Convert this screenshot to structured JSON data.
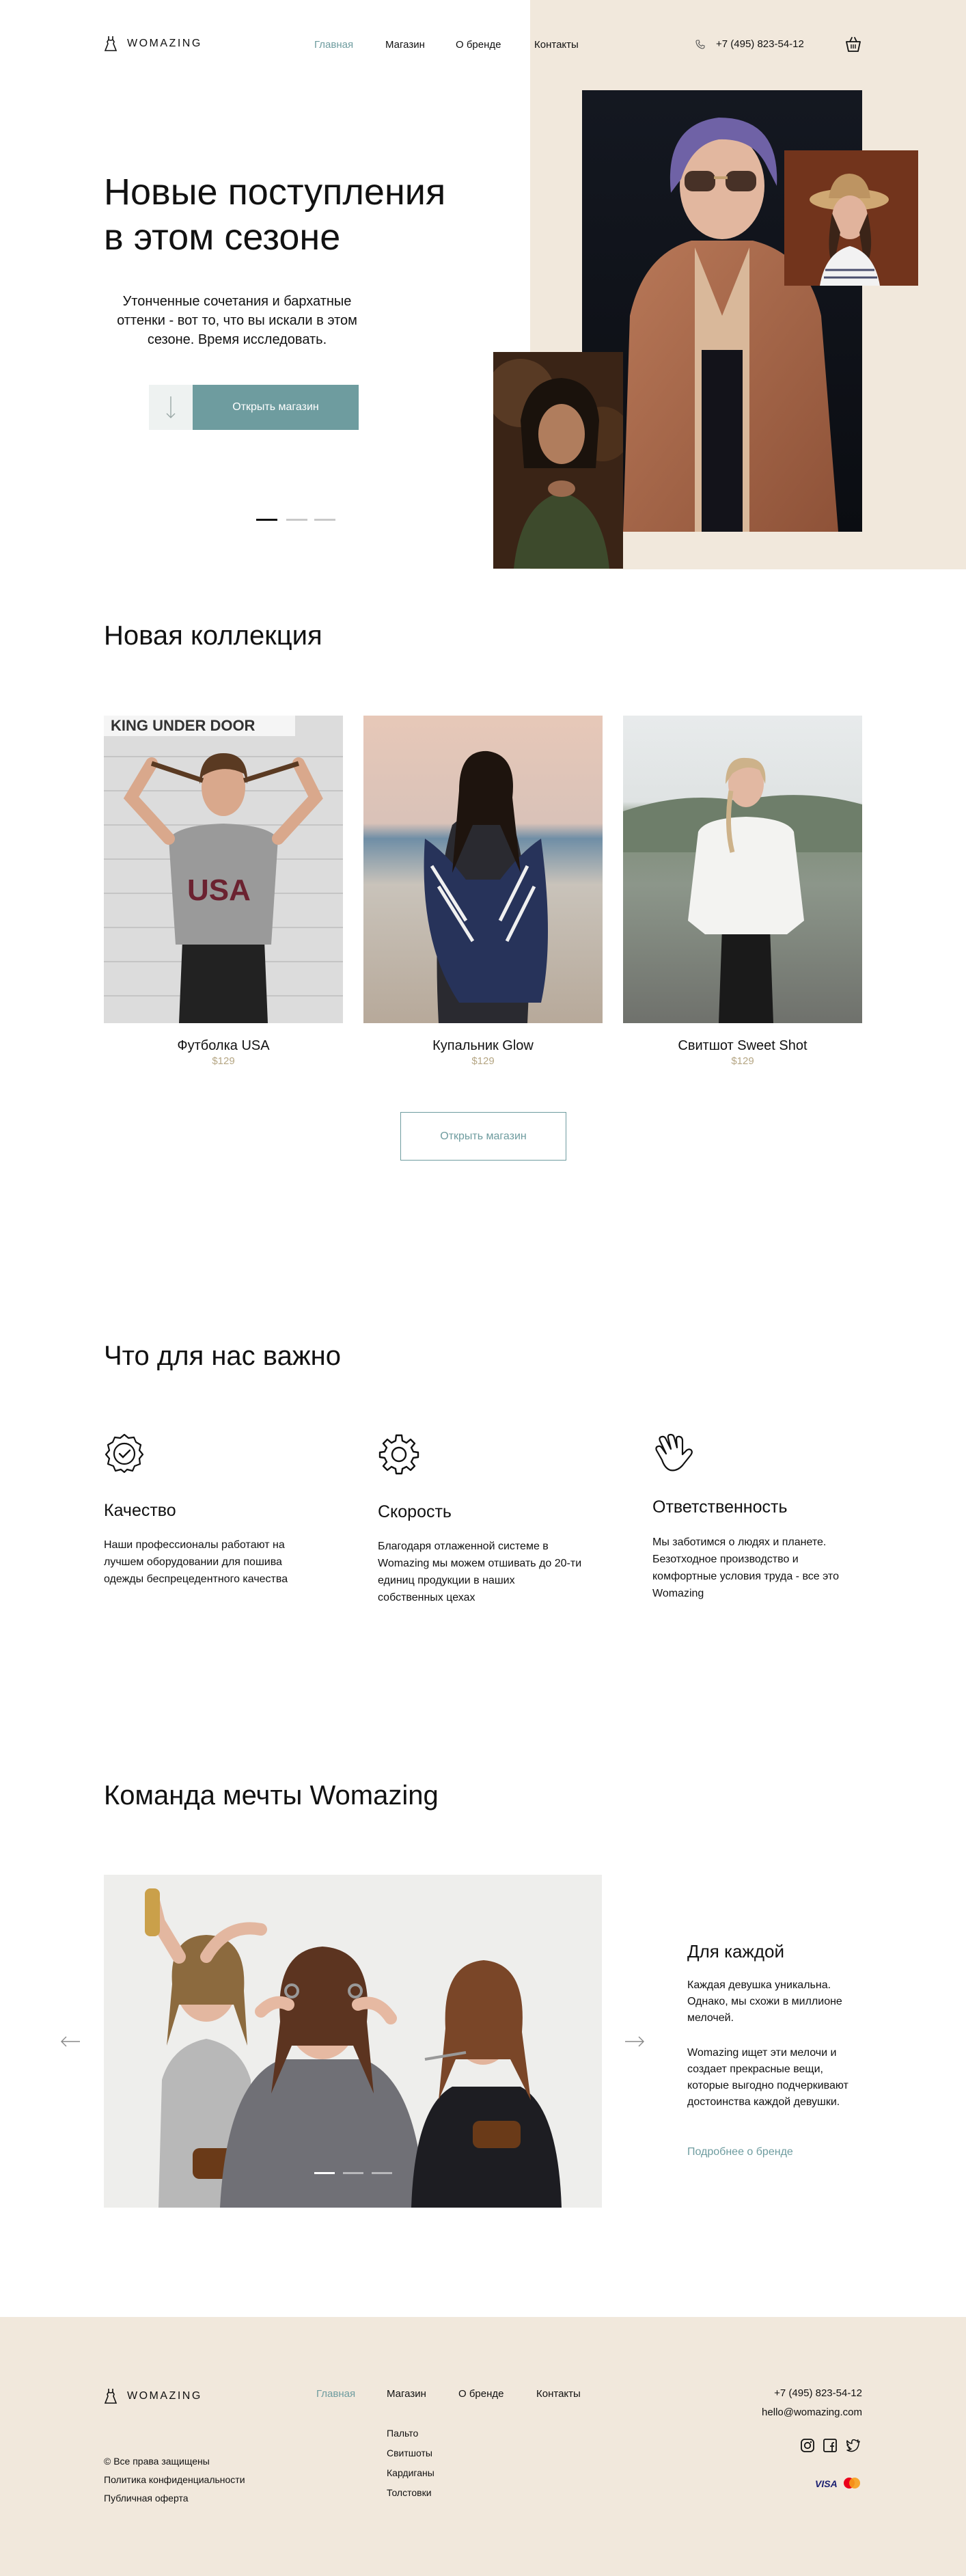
{
  "header": {
    "brand": "WOMAZING",
    "nav": [
      "Главная",
      "Магазин",
      "О бренде",
      "Контакты"
    ],
    "phone": "+7 (495) 823-54-12"
  },
  "hero": {
    "title_line1": "Новые поступления",
    "title_line2": "в этом сезоне",
    "subtitle": "Утонченные сочетания и бархатные оттенки - вот то, что вы искали в этом сезоне. Время исследовать.",
    "cta": "Открыть магазин",
    "active_slide": 1,
    "slide_count": 3
  },
  "collection": {
    "title": "Новая коллекция",
    "products": [
      {
        "name": "Футболка USA",
        "price": "$129"
      },
      {
        "name": "Купальник Glow",
        "price": "$129"
      },
      {
        "name": "Свитшот Sweet Shot",
        "price": "$129"
      }
    ],
    "cta": "Открыть магазин"
  },
  "values": {
    "title": "Что для нас важно",
    "items": [
      {
        "icon": "quality-badge-icon",
        "title": "Качество",
        "text": "Наши профессионалы работают на лучшем оборудовании для пошива одежды беспрецедентного качества"
      },
      {
        "icon": "gear-icon",
        "title": "Скорость",
        "text": "Благодаря отлаженной системе в Womazing мы можем отшивать до 20-ти единиц продукции в наших собственных цехах"
      },
      {
        "icon": "hand-icon",
        "title": "Ответственность",
        "text": "Мы заботимся о людях и планете. Безотходное производство и комфортные условия труда - все это Womazing"
      }
    ]
  },
  "team": {
    "title": "Команда мечты Womazing",
    "subtitle": "Для каждой",
    "p1": "Каждая девушка уникальна. Однако, мы схожи в миллионе мелочей.",
    "p2": "Womazing ищет эти мелочи и создает прекрасные вещи, которые выгодно подчеркивают достоинства каждой девушки.",
    "link": "Подробнее о бренде"
  },
  "footer": {
    "brand": "WOMAZING",
    "nav": [
      "Главная",
      "Магазин",
      "О бренде",
      "Контакты"
    ],
    "categories": [
      "Пальто",
      "Свитшоты",
      "Кардиганы",
      "Толстовки"
    ],
    "legal": [
      "© Все права защищены",
      "Политика конфиденциальности",
      "Публичная оферта"
    ],
    "phone": "+7 (495) 823-54-12",
    "email": "hello@womazing.com",
    "payments": [
      "VISA"
    ]
  },
  "colors": {
    "accent": "#6e9c9f",
    "beige": "#f1e8dc",
    "price": "#b5a684"
  }
}
